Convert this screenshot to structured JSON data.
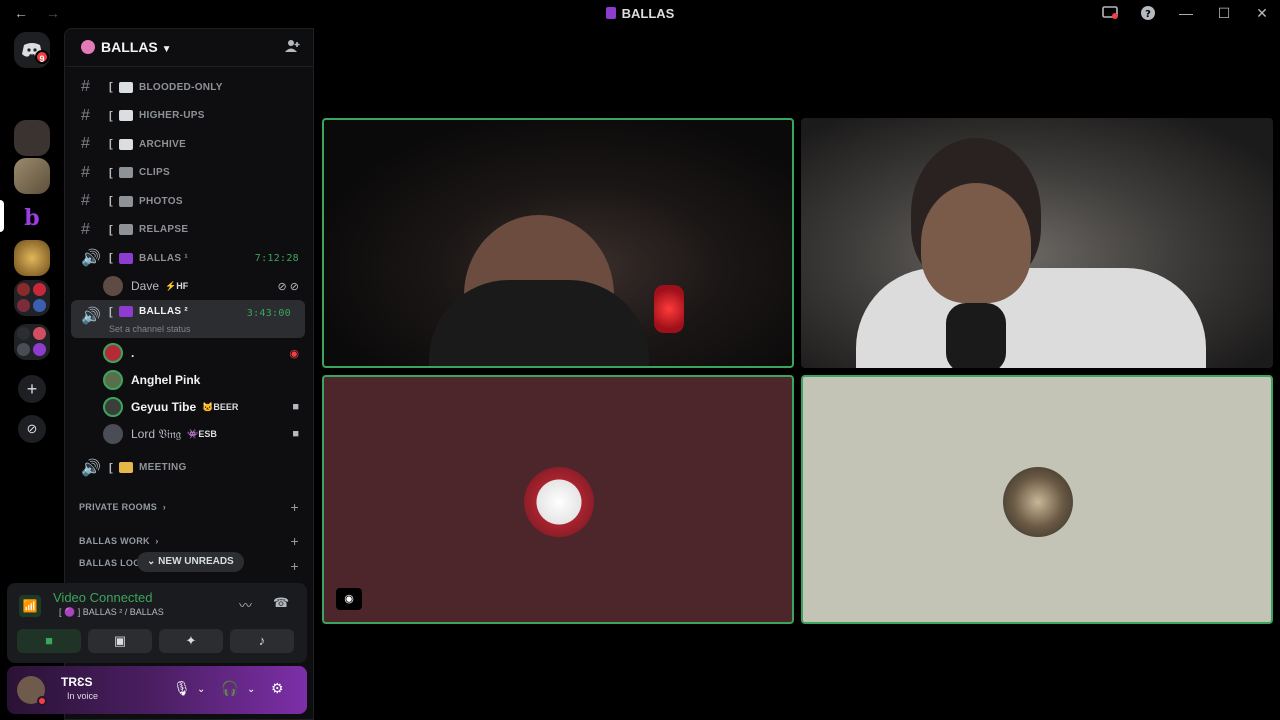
{
  "window": {
    "title": "BALLAS"
  },
  "rail": {
    "home_badge": "9"
  },
  "server": {
    "name": "BALLAS"
  },
  "channels": [
    {
      "type": "text",
      "bracket": "[",
      "name": "BLOODED-ONLY"
    },
    {
      "type": "text",
      "bracket": "[",
      "name": "HIGHER-UPS"
    },
    {
      "type": "text",
      "bracket": "[",
      "name": "ARCHIVE"
    },
    {
      "type": "text",
      "bracket": "[",
      "name": "CLIPS"
    },
    {
      "type": "text",
      "bracket": "[",
      "name": "PHOTOS"
    },
    {
      "type": "text",
      "bracket": "[",
      "name": "RELAPSE"
    }
  ],
  "voice1": {
    "name": "BALLAS ¹",
    "timer": "7:12:28",
    "users": [
      {
        "name": "Dave",
        "tag": "⚡HF"
      }
    ]
  },
  "voice2": {
    "name": "BALLAS ²",
    "timer": "3:43:00",
    "status_placeholder": "Set a channel status",
    "users": [
      {
        "name": ".",
        "tag": ""
      },
      {
        "name": "Anghel Pink",
        "tag": ""
      },
      {
        "name": "Geyuu Tibe",
        "tag": "BEER"
      },
      {
        "name": "Lord 𝔙𝔦𝔫𝔤",
        "tag": "ESB"
      }
    ]
  },
  "meeting": {
    "name": "MEETING"
  },
  "categories": {
    "private": "PRIVATE ROOMS",
    "work": "BALLAS WORK",
    "logs": "BALLAS LOGS"
  },
  "new_unreads": "NEW UNREADS",
  "voice_panel": {
    "status": "Video Connected",
    "location": "[ 🟣 ] BALLAS ² / BALLAS"
  },
  "user": {
    "name": "TRƐS",
    "status": "In voice"
  },
  "colors": {
    "speaking": "#3ba55d",
    "accent_purple": "#7d2fa8",
    "dnd": "#f23f43"
  }
}
